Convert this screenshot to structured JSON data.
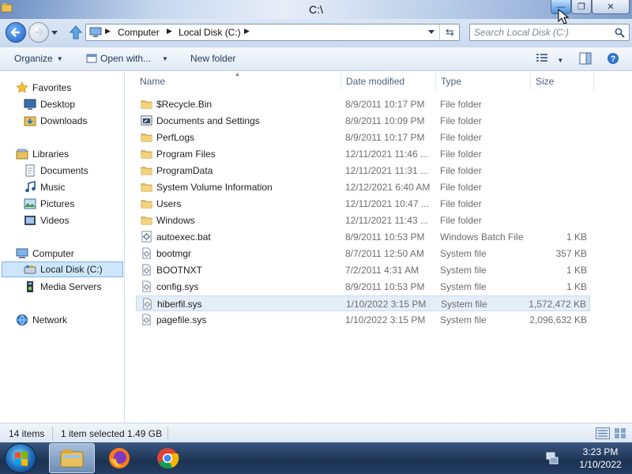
{
  "window": {
    "title": "C:\\",
    "buttons": {
      "minimize": "—",
      "maximize": "❐",
      "close": "✕"
    }
  },
  "navbar": {
    "breadcrumbs": [
      "Computer",
      "Local Disk (C:)"
    ],
    "search_placeholder": "Search Local Disk (C:)"
  },
  "toolbar": {
    "organize": "Organize",
    "open_with": "Open with...",
    "new_folder": "New folder"
  },
  "nav_pane": {
    "favorites": "Favorites",
    "desktop": "Desktop",
    "downloads": "Downloads",
    "libraries": "Libraries",
    "documents": "Documents",
    "music": "Music",
    "pictures": "Pictures",
    "videos": "Videos",
    "computer": "Computer",
    "local_disk": "Local Disk (C:)",
    "media_servers": "Media Servers",
    "network": "Network"
  },
  "columns": {
    "name": "Name",
    "date": "Date modified",
    "type": "Type",
    "size": "Size"
  },
  "files": [
    {
      "name": "$Recycle.Bin",
      "date": "8/9/2011 10:17 PM",
      "type": "File folder",
      "size": "",
      "icon": "folder"
    },
    {
      "name": "Documents and Settings",
      "date": "8/9/2011 10:09 PM",
      "type": "File folder",
      "size": "",
      "icon": "shortcut-folder"
    },
    {
      "name": "PerfLogs",
      "date": "8/9/2011 10:17 PM",
      "type": "File folder",
      "size": "",
      "icon": "folder"
    },
    {
      "name": "Program Files",
      "date": "12/11/2021 11:46 ...",
      "type": "File folder",
      "size": "",
      "icon": "folder"
    },
    {
      "name": "ProgramData",
      "date": "12/11/2021 11:31 ...",
      "type": "File folder",
      "size": "",
      "icon": "folder"
    },
    {
      "name": "System Volume Information",
      "date": "12/12/2021 6:40 AM",
      "type": "File folder",
      "size": "",
      "icon": "folder"
    },
    {
      "name": "Users",
      "date": "12/11/2021 10:47 ...",
      "type": "File folder",
      "size": "",
      "icon": "folder"
    },
    {
      "name": "Windows",
      "date": "12/11/2021 11:43 ...",
      "type": "File folder",
      "size": "",
      "icon": "folder"
    },
    {
      "name": "autoexec.bat",
      "date": "8/9/2011 10:53 PM",
      "type": "Windows Batch File",
      "size": "1 KB",
      "icon": "batch-file"
    },
    {
      "name": "bootmgr",
      "date": "8/7/2011 12:50 AM",
      "type": "System file",
      "size": "357 KB",
      "icon": "system-file"
    },
    {
      "name": "BOOTNXT",
      "date": "7/2/2011 4:31 AM",
      "type": "System file",
      "size": "1 KB",
      "icon": "system-file"
    },
    {
      "name": "config.sys",
      "date": "8/9/2011 10:53 PM",
      "type": "System file",
      "size": "1 KB",
      "icon": "system-file"
    },
    {
      "name": "hiberfil.sys",
      "date": "1/10/2022 3:15 PM",
      "type": "System file",
      "size": "1,572,472 KB",
      "icon": "system-file",
      "selected": true
    },
    {
      "name": "pagefile.sys",
      "date": "1/10/2022 3:15 PM",
      "type": "System file",
      "size": "2,096,632 KB",
      "icon": "system-file"
    }
  ],
  "status": {
    "items_count": "14 items",
    "selection": "1 item selected  1.49 GB"
  },
  "taskbar": {
    "time": "3:23 PM",
    "date": "1/10/2022",
    "apps": [
      "windows-explorer-icon",
      "firefox-icon",
      "chrome-icon"
    ]
  },
  "colors": {
    "folder": "#e8c15a",
    "selection": "#e4eef9",
    "link_text": "#1e395b",
    "taskbar": "#1c3352"
  }
}
